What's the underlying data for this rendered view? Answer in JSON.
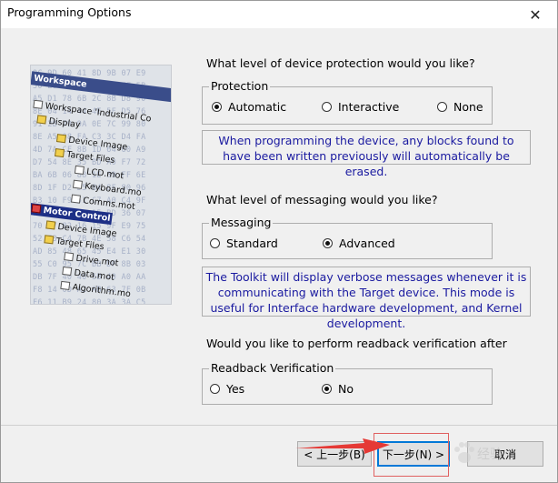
{
  "window": {
    "title": "Programming Options",
    "close_glyph": "✕"
  },
  "illustration": {
    "hex_rows": [
      "9C 9D 60 41 8D 9B 07 E9",
      "50 E0 B0 F2 8E DA FF 5B",
      "A5 D1 78 6B 2C 8B D8 90",
      "8E 04 14 44 4E 5F D5 76",
      "91 2B 79 9A 0E 7C 99 80",
      "8E A5 08 FA C3 3C D4 FA",
      "4D 7A CF 8B 1D 64 60 A9",
      "D7 54 8E 35 BD A0 F7 72",
      "BA 6B 06 88 1E 89 FF 6E",
      "8D 1F D2 D5 84 8F 80 96",
      "B3 10 F9 51 C7 A0 C4 9F",
      "F6 6D 7F 3D 15 BD 36 07",
      "70 47 82 16 15 9F E9 75",
      "52 E3 C4 7B 4E 58 C6 54",
      "AD 85 48 65 45 E4 E1 30",
      "55 C0 95 7C BB DF 8B 03",
      "DB 7F 40 40 5B 40 A0 AA",
      "F8 14 0D A2 AB 63 7F 0B",
      "F6 11 B9 24 80 3A 3A C5",
      "5D 9A DE 46 85 89 97 B5",
      "5A 94 55 F8 46 B2 31 6E",
      "8D 1A BF 85 EB 76 82 2C",
      "4F EF E4 B4 B0 B3 2D F6",
      "00 F1 36 AF 48 53 51 10"
    ],
    "workspace_label": "Workspace",
    "tree": [
      {
        "label": "Workspace 'Industrial Co",
        "icon": "doc"
      },
      {
        "label": "Display",
        "icon": "folder"
      },
      {
        "label": "Device Image",
        "icon": "folder"
      },
      {
        "label": "Target Files",
        "icon": "folder"
      },
      {
        "label": "LCD.mot",
        "icon": "s-file"
      },
      {
        "label": "Keyboard.mo",
        "icon": "s-file"
      },
      {
        "label": "Comms.mot",
        "icon": "s-file"
      },
      {
        "label": "Motor Control",
        "icon": "chip"
      },
      {
        "label": "Device Image",
        "icon": "folder"
      },
      {
        "label": "Target Files",
        "icon": "folder"
      },
      {
        "label": "Drive.mot",
        "icon": "s-file"
      },
      {
        "label": "Data.mot",
        "icon": "s-file"
      },
      {
        "label": "Algorithm.mo",
        "icon": "s-file"
      }
    ]
  },
  "protection": {
    "question": "What level of device protection would you like?",
    "group_label": "Protection",
    "options": [
      "Automatic",
      "Interactive",
      "None"
    ],
    "selected": "Automatic",
    "info": "When programming the device, any blocks found to have been written previously will automatically be erased."
  },
  "messaging": {
    "question": "What level of messaging would you like?",
    "group_label": "Messaging",
    "options": [
      "Standard",
      "Advanced"
    ],
    "selected": "Advanced",
    "info": "The Toolkit will display verbose messages whenever it is communicating with the Target device. This mode is useful for Interface hardware development, and Kernel development."
  },
  "readback": {
    "question": "Would you like to perform readback verification after",
    "group_label": "Readback Verification",
    "options": [
      "Yes",
      "No"
    ],
    "selected": "No"
  },
  "buttons": {
    "back": "< 上一步(B)",
    "next": "下一步(N) >",
    "cancel": "取消"
  },
  "watermark": {
    "text": "经验"
  },
  "annotation_colors": {
    "arrow": "#e53935",
    "highlight_box": "#e06060",
    "info_text": "#1a1aa0"
  }
}
